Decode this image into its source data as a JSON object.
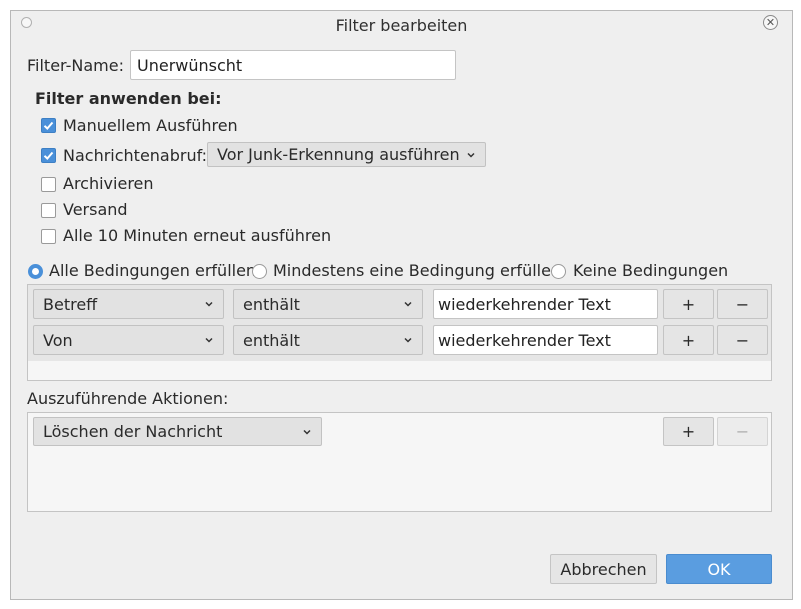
{
  "window": {
    "title": "Filter bearbeiten"
  },
  "filter_name": {
    "label": "Filter-Name:",
    "value": "Unerwünscht"
  },
  "apply_when": {
    "heading": "Filter anwenden bei:",
    "manual": {
      "label": "Manuellem Ausführen",
      "checked": true
    },
    "fetch": {
      "label": "Nachrichtenabruf:",
      "checked": true,
      "dropdown": "Vor Junk-Erkennung ausführen"
    },
    "archive": {
      "label": "Archivieren",
      "checked": false
    },
    "send": {
      "label": "Versand",
      "checked": false
    },
    "periodic": {
      "label": "Alle 10 Minuten erneut ausführen",
      "checked": false
    }
  },
  "match": {
    "options": [
      "Alle Bedingungen erfüllen",
      "Mindestens eine Bedingung erfüllen",
      "Keine Bedingungen"
    ],
    "selected": 0
  },
  "conditions": [
    {
      "field": "Betreff",
      "operator": "enthält",
      "value": "wiederkehrender Text",
      "add": "+",
      "remove": "−"
    },
    {
      "field": "Von",
      "operator": "enthält",
      "value": "wiederkehrender Text",
      "add": "+",
      "remove": "−"
    }
  ],
  "actions": {
    "label": "Auszuführende Aktionen:",
    "items": [
      {
        "action": "Löschen der Nachricht",
        "add": "+",
        "remove": "−"
      }
    ]
  },
  "buttons": {
    "cancel": "Abbrechen",
    "ok": "OK"
  },
  "colors": {
    "accent": "#4a90d9",
    "ok_button": "#5a9de0"
  }
}
